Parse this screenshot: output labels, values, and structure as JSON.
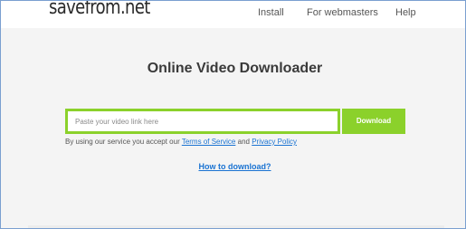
{
  "header": {
    "logo": "savefrom.net",
    "nav": {
      "install": "Install",
      "webmasters": "For webmasters",
      "help": "Help"
    }
  },
  "main": {
    "title": "Online Video Downloader",
    "search": {
      "placeholder": "Paste your video link here",
      "value": ""
    },
    "download_label": "Download",
    "terms": {
      "prefix": "By using our service you accept our ",
      "tos": "Terms of Service",
      "and": " and ",
      "privacy": "Privacy Policy"
    },
    "howto": "How to download?"
  },
  "colors": {
    "accent": "#8bd12b",
    "link": "#1a73d2",
    "background": "#f4f4f4",
    "frame": "#7a9fd0"
  }
}
